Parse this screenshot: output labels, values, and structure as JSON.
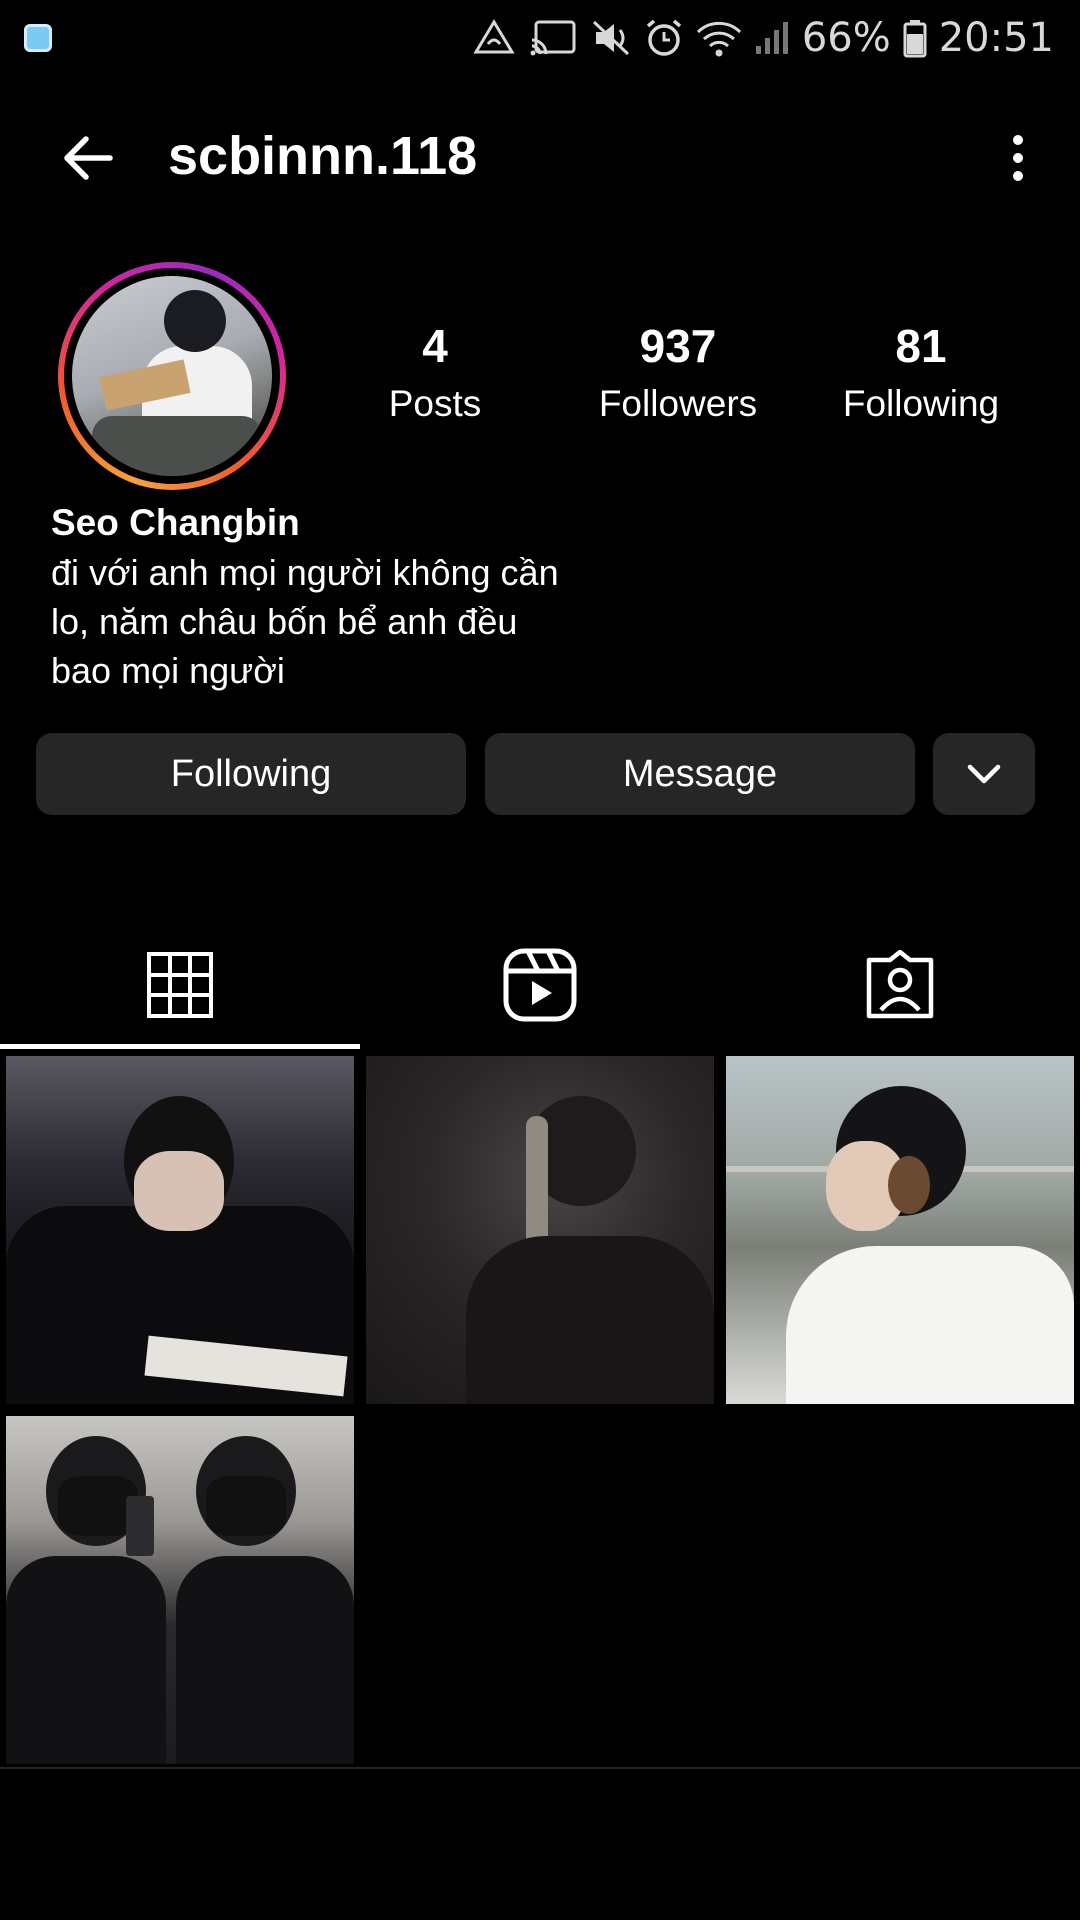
{
  "status_bar": {
    "battery": "66%",
    "time": "20:51"
  },
  "header": {
    "username": "scbinnn.118"
  },
  "profile": {
    "stats": [
      {
        "value": "4",
        "label": "Posts"
      },
      {
        "value": "937",
        "label": "Followers"
      },
      {
        "value": "81",
        "label": "Following"
      }
    ],
    "full_name": "Seo Changbin",
    "bio_lines": [
      "đi với anh mọi người không cần",
      "lo, năm châu bốn bể anh đều",
      "bao mọi người"
    ]
  },
  "actions": {
    "following_label": "Following",
    "message_label": "Message"
  },
  "tabs": [
    {
      "icon": "grid-icon",
      "selected": true
    },
    {
      "icon": "reels-icon",
      "selected": false
    },
    {
      "icon": "tagged-icon",
      "selected": false
    }
  ],
  "posts_count_shown": 4,
  "colors": {
    "background": "#000000",
    "button_bg": "#262626",
    "text": "#ffffff"
  }
}
